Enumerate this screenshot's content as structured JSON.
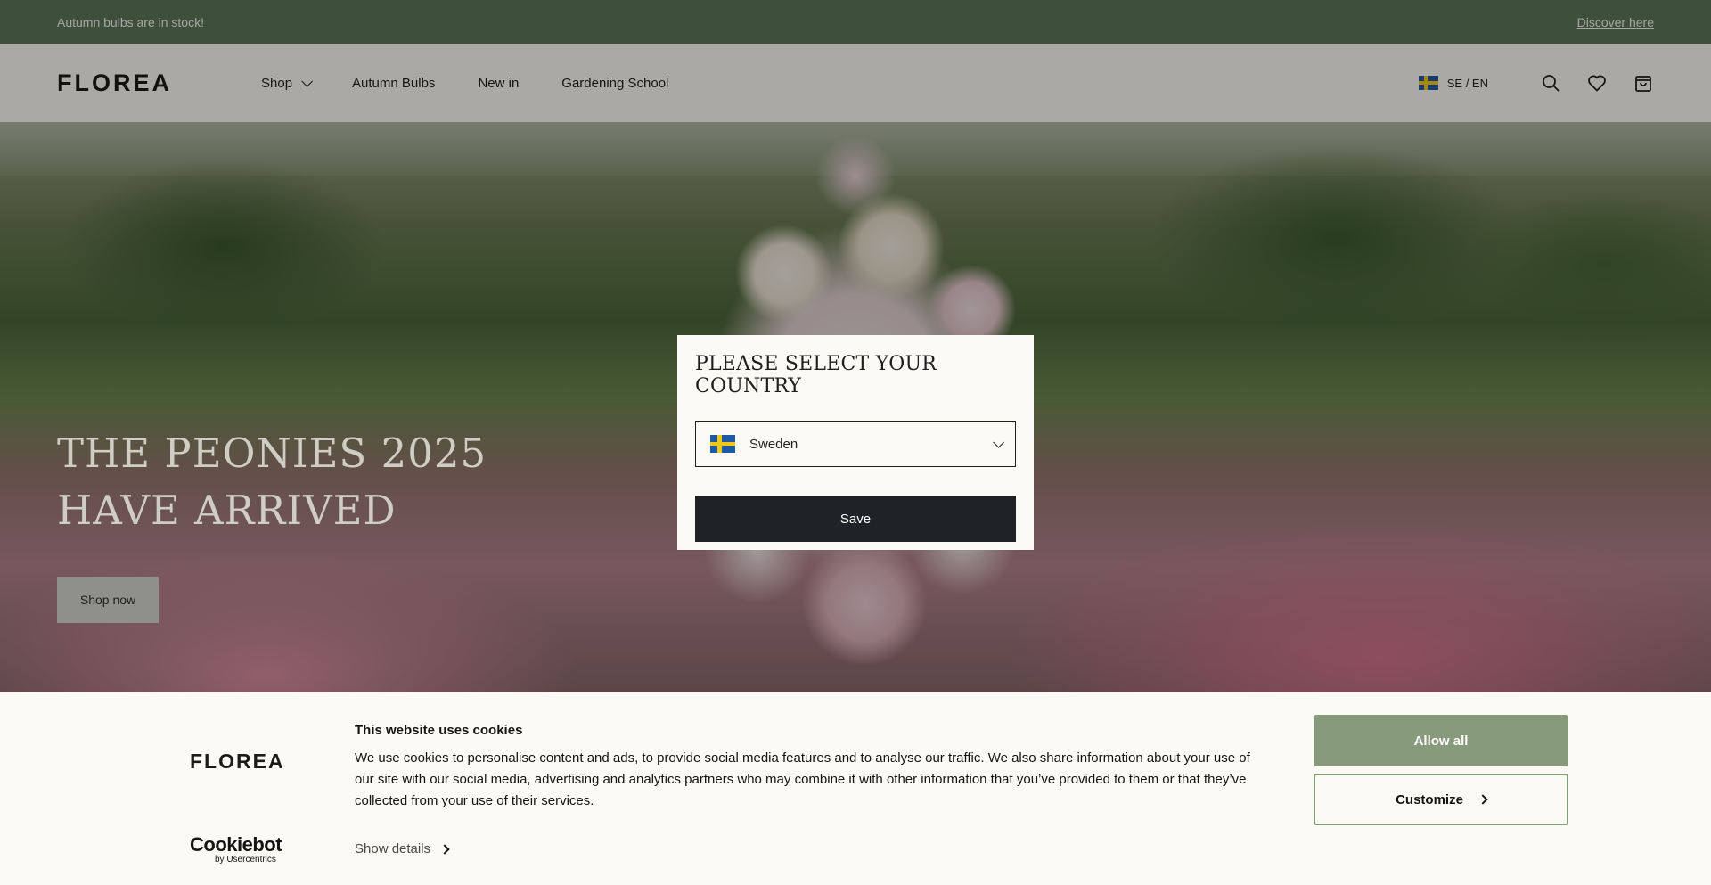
{
  "announcement": {
    "text": "Autumn bulbs are in stock!",
    "link": "Discover here"
  },
  "header": {
    "logo": "FLOREA",
    "nav": [
      {
        "label": "Shop",
        "has_dropdown": true
      },
      {
        "label": "Autumn Bulbs"
      },
      {
        "label": "New in"
      },
      {
        "label": "Gardening School"
      }
    ],
    "locale": "SE / EN",
    "icons": [
      "search-icon",
      "heart-icon",
      "bag-icon"
    ]
  },
  "hero": {
    "title": "THE PEONIES 2025 HAVE ARRIVED",
    "button": "Shop now"
  },
  "country_modal": {
    "title": "PLEASE SELECT YOUR COUNTRY",
    "selected_country": "Sweden",
    "save_label": "Save"
  },
  "cookie_banner": {
    "logo": "FLOREA",
    "title": "This website uses cookies",
    "text": "We use cookies to personalise content and ads, to provide social media features and to analyse our traffic. We also share information about your use of our site with our social media, advertising and analytics partners who may combine it with other information that you’ve provided to them or that they’ve collected from your use of their services.",
    "show_details": "Show details",
    "allow_all": "Allow all",
    "customize": "Customize",
    "provider_logo": "Cookiebot",
    "provider_sub": "by Usercentrics"
  },
  "colors": {
    "announcement_bg": "#5c7659",
    "accent_green": "#889a7c",
    "dark_button": "#1f2227",
    "cream": "#fbfaf5"
  }
}
